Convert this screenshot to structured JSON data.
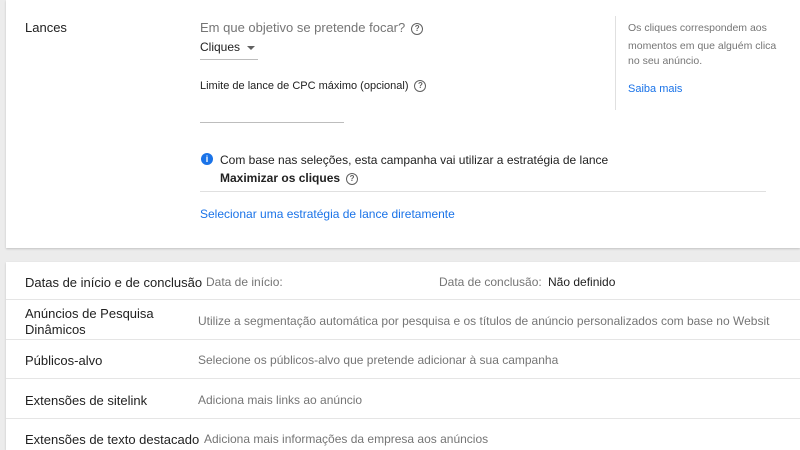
{
  "bids": {
    "section_label": "Lances",
    "objective_question": "Em que objetivo se pretende focar?",
    "objective_value": "Cliques",
    "cpc_label": "Limite de lance de CPC máximo (opcional)",
    "cpc_value": "",
    "info_text": "Com base nas seleções, esta campanha vai utilizar a estratégia de lance",
    "strategy_name": "Maximizar os cliques",
    "select_strategy_link": "Selecionar uma estratégia de lance diretamente",
    "side_help": [
      "Os cliques correspondem aos",
      "momentos em que alguém clica",
      "no seu anúncio."
    ],
    "learn_more_link": "Saiba mais"
  },
  "settings": {
    "dates": {
      "label": "Datas de início e de conclusão",
      "start_label": "Data de início:",
      "start_value": "",
      "end_label": "Data de conclusão:",
      "end_value": "Não definido"
    },
    "dynamic_search_ads": {
      "label_line1": "Anúncios de Pesquisa",
      "label_line2": "Dinâmicos",
      "description": "Utilize a segmentação automática por pesquisa e os títulos de anúncio personalizados com base no Websit"
    },
    "audiences": {
      "label": "Públicos-alvo",
      "description": "Selecione os públicos-alvo que pretende adicionar à sua campanha"
    },
    "sitelinks": {
      "label": "Extensões de sitelink",
      "description": "Adiciona mais links ao anúncio"
    },
    "callouts": {
      "label": "Extensões de texto destacado",
      "description": "Adiciona mais informações da empresa aos anúncios"
    }
  },
  "colors": {
    "link": "#1a73e8",
    "info": "#1a73e8",
    "background": "#ececec"
  },
  "icons": [
    "help-icon",
    "info-icon",
    "dropdown-caret-icon"
  ]
}
